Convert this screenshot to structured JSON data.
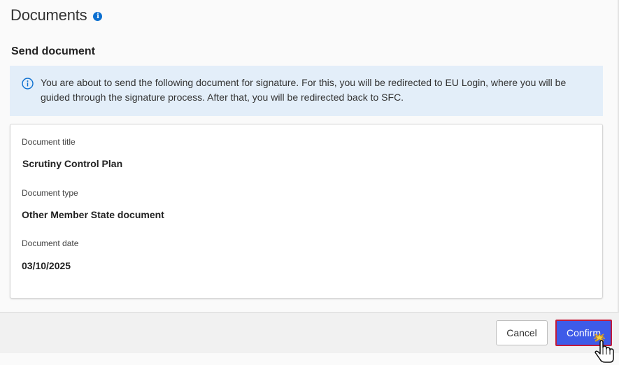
{
  "header": {
    "title": "Documents",
    "info_icon": "info-icon"
  },
  "dialog": {
    "section_title": "Send document",
    "alert": {
      "icon": "info-circle-icon",
      "text": "You are about to send the following document for signature. For this, you will be redirected to EU Login, where you will be guided through the signature process. After that, you will be redirected back to SFC."
    },
    "fields": [
      {
        "label": "Document title",
        "value": "Scrutiny Control Plan"
      },
      {
        "label": "Document type",
        "value": "Other Member State document"
      },
      {
        "label": "Document date",
        "value": "03/10/2025"
      }
    ]
  },
  "footer": {
    "cancel_label": "Cancel",
    "confirm_label": "Confirm"
  },
  "colors": {
    "accent": "#3e5be8",
    "alert_bg": "#e3eef9",
    "info_blue": "#0b6fd0",
    "highlight_border": "#c21b3b"
  }
}
